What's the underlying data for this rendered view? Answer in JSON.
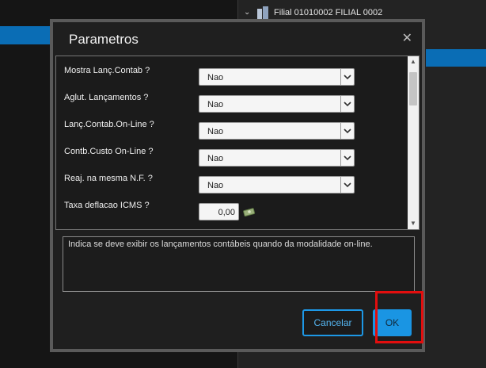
{
  "background": {
    "tree_item_label": "Filial 01010002 FILIAL 0002",
    "tree_chevron_icon": "chevron-down-icon",
    "tree_item_icon": "building-icon"
  },
  "dialog": {
    "title": "Parametros",
    "close_icon": "close-icon",
    "params": [
      {
        "label": "Mostra Lanç.Contab ?",
        "value": "Nao",
        "type": "select"
      },
      {
        "label": "Aglut. Lançamentos ?",
        "value": "Nao",
        "type": "select"
      },
      {
        "label": "Lanç.Contab.On-Line ?",
        "value": "Nao",
        "type": "select"
      },
      {
        "label": "Contb.Custo On-Line ?",
        "value": "Nao",
        "type": "select"
      },
      {
        "label": "Reaj. na mesma N.F. ?",
        "value": "Nao",
        "type": "select"
      },
      {
        "label": "Taxa deflacao ICMS ?",
        "value": "0,00",
        "type": "number",
        "icon": "money-icon"
      }
    ],
    "help_text": "Indica se deve exibir os lançamentos contábeis quando da modalidade on-line.",
    "buttons": {
      "cancel_label": "Cancelar",
      "ok_label": "OK"
    },
    "colors": {
      "accent": "#1a95e3",
      "highlight_ring": "#e20e0e"
    }
  }
}
